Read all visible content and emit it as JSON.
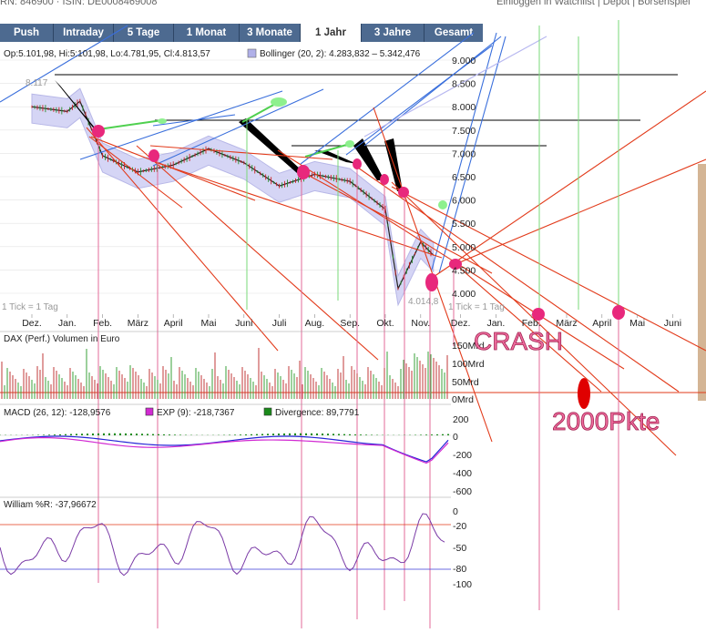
{
  "top_strip": {
    "left": "RN: 846900 · ISIN: DE0008469008",
    "right": "Einloggen in Watchlist | Depot | Börsenspiel"
  },
  "tabs": [
    {
      "label": "Push",
      "active": false
    },
    {
      "label": "Intraday",
      "active": false
    },
    {
      "label": "5 Tage",
      "active": false
    },
    {
      "label": "1 Monat",
      "active": false
    },
    {
      "label": "3 Monate",
      "active": false
    },
    {
      "label": "1 Jahr",
      "active": true
    },
    {
      "label": "3 Jahre",
      "active": false
    },
    {
      "label": "Gesamt",
      "active": false
    }
  ],
  "price_panel": {
    "ohlc": "Op:5.101,98, Hi:5:101,98, Lo:4.781,95, Cl:4.813,57",
    "bollinger": "Bollinger (20, 2): 4.283,832 – 5.342,476",
    "tick_note": "1 Tick = 1 Tag",
    "max_label": "8.117",
    "min_label": "4.014,8"
  },
  "volume_panel": {
    "title": "DAX (Perf.) Volumen in Euro",
    "ticks": [
      "150Mrd",
      "100Mrd",
      "50Mrd",
      "0Mrd"
    ]
  },
  "macd_panel": {
    "macd": "MACD (26, 12): -128,9576",
    "exp": "EXP (9): -218,7367",
    "divergence": "Divergence: 89,7791",
    "ticks": [
      "200",
      "0",
      "-200",
      "-400",
      "-600"
    ]
  },
  "williams_panel": {
    "title": "William %R: -37,96672",
    "ticks": [
      "0",
      "-20",
      "-50",
      "-80",
      "-100"
    ]
  },
  "annotations": {
    "crash": "CRASH",
    "target": "2000Pkte"
  },
  "chart_data": {
    "type": "line",
    "title": "",
    "x_tick_labels": [
      "Dez.",
      "Jan.",
      "Feb.",
      "März",
      "April",
      "Mai",
      "Juni",
      "Juli",
      "Aug.",
      "Sep.",
      "Okt.",
      "Nov.",
      "Dez.",
      "Jan.",
      "Feb.",
      "März",
      "April",
      "Mai",
      "Juni"
    ],
    "y_tick_labels": [
      "9.000",
      "8.500",
      "8.000",
      "7.500",
      "7.000",
      "6.500",
      "6.000",
      "5.500",
      "5.000",
      "4.500",
      "4.000"
    ],
    "ylim": [
      4000,
      9000
    ],
    "price_series": [
      {
        "month": "Dez.",
        "close": 8000
      },
      {
        "month": "Jan.",
        "close": 7900
      },
      {
        "month": "Jan.",
        "close": 8117
      },
      {
        "month": "Feb.",
        "close": 6950
      },
      {
        "month": "März",
        "close": 6600
      },
      {
        "month": "April",
        "close": 6750
      },
      {
        "month": "Mai",
        "close": 7100
      },
      {
        "month": "Juni",
        "close": 6800
      },
      {
        "month": "Juli",
        "close": 6300
      },
      {
        "month": "Aug.",
        "close": 6550
      },
      {
        "month": "Sep.",
        "close": 6400
      },
      {
        "month": "Okt.",
        "close": 5800
      },
      {
        "month": "Okt.",
        "close": 4100
      },
      {
        "month": "Nov.",
        "close": 5100
      },
      {
        "month": "Nov.",
        "close": 4813.57
      }
    ],
    "horizontal_levels": [
      8450,
      7300,
      6700
    ],
    "colors": {
      "price": "#222222",
      "bollinger": "#9f9fe0",
      "support": "#000000",
      "trend_blue": "#3a6fdc",
      "trend_red": "#e23a1a",
      "marker": "#e8287c",
      "green": "#4fd04f",
      "macd": "#2424d6",
      "exp": "#d22ad2",
      "williams": "#7a3aa6"
    }
  }
}
